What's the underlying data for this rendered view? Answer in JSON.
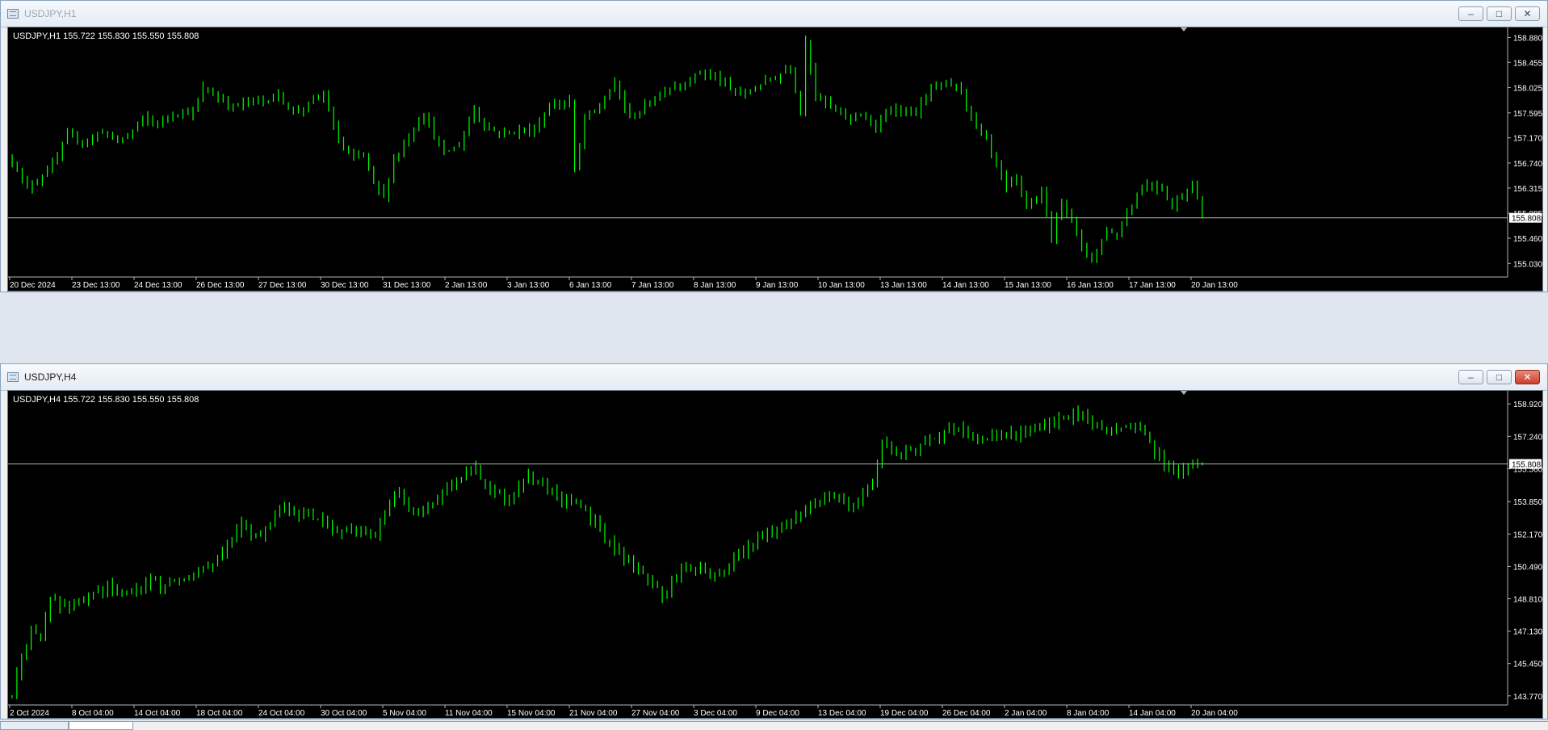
{
  "windows": [
    {
      "title": "USDJPY,H1",
      "active": false,
      "info": "USDJPY,H1  155.722 155.830 155.550 155.808",
      "chart_data": {
        "type": "candlestick",
        "symbol": "USDJPY",
        "timeframe": "H1",
        "ylim": [
          154.8,
          159.05
        ],
        "y_ticks": [
          "158.880",
          "158.455",
          "158.025",
          "157.595",
          "157.170",
          "156.740",
          "156.315",
          "155.885",
          "155.460",
          "155.030"
        ],
        "x_ticks": [
          "20 Dec 2024",
          "23 Dec 13:00",
          "24 Dec 13:00",
          "26 Dec 13:00",
          "27 Dec 13:00",
          "30 Dec 13:00",
          "31 Dec 13:00",
          "2 Jan 13:00",
          "3 Jan 13:00",
          "6 Jan 13:00",
          "7 Jan 13:00",
          "8 Jan 13:00",
          "9 Jan 13:00",
          "10 Jan 13:00",
          "13 Jan 13:00",
          "14 Jan 13:00",
          "15 Jan 13:00",
          "16 Jan 13:00",
          "17 Jan 13:00",
          "20 Jan 13:00"
        ],
        "current_price": "155.808",
        "path": [
          [
            0,
            156.8
          ],
          [
            3,
            156.3
          ],
          [
            6,
            156.55
          ],
          [
            8,
            156.7
          ],
          [
            11,
            157.2
          ],
          [
            15,
            157.1
          ],
          [
            18,
            157.3
          ],
          [
            21,
            157.1
          ],
          [
            24,
            157.3
          ],
          [
            26,
            157.5
          ],
          [
            29,
            157.4
          ],
          [
            32,
            157.6
          ],
          [
            36,
            157.6
          ],
          [
            38,
            158.0
          ],
          [
            40,
            157.9
          ],
          [
            44,
            157.7
          ],
          [
            47,
            157.8
          ],
          [
            50,
            157.8
          ],
          [
            53,
            157.9
          ],
          [
            56,
            157.6
          ],
          [
            60,
            157.8
          ],
          [
            62,
            157.9
          ],
          [
            65,
            157.1
          ],
          [
            68,
            156.8
          ],
          [
            70,
            156.9
          ],
          [
            72,
            156.4
          ],
          [
            74,
            156.15
          ],
          [
            76,
            156.8
          ],
          [
            79,
            157.2
          ],
          [
            82,
            157.6
          ],
          [
            84,
            157.2
          ],
          [
            86,
            156.9
          ],
          [
            89,
            157.05
          ],
          [
            92,
            157.65
          ],
          [
            95,
            157.3
          ],
          [
            98,
            157.25
          ],
          [
            101,
            157.3
          ],
          [
            104,
            157.3
          ],
          [
            107,
            157.7
          ],
          [
            111,
            157.8
          ],
          [
            112,
            156.6
          ],
          [
            114,
            157.5
          ],
          [
            117,
            157.7
          ],
          [
            120,
            158.1
          ],
          [
            123,
            157.5
          ],
          [
            126,
            157.7
          ],
          [
            130,
            158.0
          ],
          [
            134,
            158.1
          ],
          [
            137,
            158.3
          ],
          [
            140,
            158.2
          ],
          [
            143,
            158.0
          ],
          [
            146,
            157.9
          ],
          [
            149,
            158.1
          ],
          [
            152,
            158.2
          ],
          [
            155,
            158.4
          ],
          [
            157,
            157.6
          ],
          [
            158,
            158.85
          ],
          [
            160,
            157.9
          ],
          [
            163,
            157.7
          ],
          [
            166,
            157.5
          ],
          [
            169,
            157.6
          ],
          [
            172,
            157.3
          ],
          [
            175,
            157.7
          ],
          [
            178,
            157.6
          ],
          [
            180,
            157.6
          ],
          [
            183,
            158.0
          ],
          [
            186,
            158.1
          ],
          [
            189,
            158.0
          ],
          [
            191,
            157.5
          ],
          [
            194,
            157.1
          ],
          [
            196,
            156.7
          ],
          [
            198,
            156.3
          ],
          [
            200,
            156.5
          ],
          [
            202,
            156.0
          ],
          [
            205,
            156.2
          ],
          [
            207,
            155.5
          ],
          [
            209,
            156.1
          ],
          [
            211,
            155.8
          ],
          [
            213,
            155.3
          ],
          [
            215,
            155.1
          ],
          [
            218,
            155.6
          ],
          [
            220,
            155.5
          ],
          [
            222,
            155.9
          ],
          [
            224,
            156.2
          ],
          [
            226,
            156.4
          ],
          [
            229,
            156.3
          ],
          [
            231,
            156.0
          ],
          [
            233,
            156.2
          ],
          [
            235,
            156.4
          ],
          [
            237,
            155.85
          ]
        ]
      }
    },
    {
      "title": "USDJPY,H4",
      "active": true,
      "info": "USDJPY,H4  155.722 155.830 155.550 155.808",
      "chart_data": {
        "type": "candlestick",
        "symbol": "USDJPY",
        "timeframe": "H4",
        "ylim": [
          143.3,
          159.6
        ],
        "y_ticks": [
          "158.920",
          "157.240",
          "155.560",
          "153.850",
          "152.170",
          "150.490",
          "148.810",
          "147.130",
          "145.450",
          "143.770"
        ],
        "x_ticks": [
          "2 Oct 2024",
          "8 Oct 04:00",
          "14 Oct 04:00",
          "18 Oct 04:00",
          "24 Oct 04:00",
          "30 Oct 04:00",
          "5 Nov 04:00",
          "11 Nov 04:00",
          "15 Nov 04:00",
          "21 Nov 04:00",
          "27 Nov 04:00",
          "3 Dec 04:00",
          "9 Dec 04:00",
          "13 Dec 04:00",
          "19 Dec 04:00",
          "26 Dec 04:00",
          "2 Jan 04:00",
          "8 Jan 04:00",
          "14 Jan 04:00",
          "20 Jan 04:00"
        ],
        "current_price": "155.808",
        "path": [
          [
            0,
            143.8
          ],
          [
            2,
            146.0
          ],
          [
            4,
            147.0
          ],
          [
            6,
            146.8
          ],
          [
            8,
            148.8
          ],
          [
            12,
            148.2
          ],
          [
            16,
            148.9
          ],
          [
            20,
            149.5
          ],
          [
            24,
            149.0
          ],
          [
            28,
            149.7
          ],
          [
            32,
            149.5
          ],
          [
            36,
            150.0
          ],
          [
            40,
            150.3
          ],
          [
            44,
            151.2
          ],
          [
            48,
            152.6
          ],
          [
            52,
            152.0
          ],
          [
            56,
            153.5
          ],
          [
            60,
            153.2
          ],
          [
            64,
            153.0
          ],
          [
            68,
            152.3
          ],
          [
            72,
            152.5
          ],
          [
            76,
            152.0
          ],
          [
            80,
            154.5
          ],
          [
            84,
            153.1
          ],
          [
            88,
            153.8
          ],
          [
            92,
            154.8
          ],
          [
            96,
            155.7
          ],
          [
            100,
            154.5
          ],
          [
            104,
            154.0
          ],
          [
            108,
            155.2
          ],
          [
            112,
            154.4
          ],
          [
            116,
            153.9
          ],
          [
            120,
            153.5
          ],
          [
            124,
            152.0
          ],
          [
            128,
            150.8
          ],
          [
            132,
            150.2
          ],
          [
            136,
            149.0
          ],
          [
            140,
            150.5
          ],
          [
            144,
            150.3
          ],
          [
            148,
            150.0
          ],
          [
            152,
            151.2
          ],
          [
            156,
            151.9
          ],
          [
            160,
            152.5
          ],
          [
            164,
            153.0
          ],
          [
            168,
            153.8
          ],
          [
            172,
            154.2
          ],
          [
            176,
            153.5
          ],
          [
            180,
            155.0
          ],
          [
            182,
            157.0
          ],
          [
            186,
            156.3
          ],
          [
            190,
            156.8
          ],
          [
            194,
            157.3
          ],
          [
            198,
            157.6
          ],
          [
            202,
            157.0
          ],
          [
            206,
            157.2
          ],
          [
            210,
            157.3
          ],
          [
            214,
            157.8
          ],
          [
            218,
            157.9
          ],
          [
            222,
            158.4
          ],
          [
            226,
            157.9
          ],
          [
            230,
            157.5
          ],
          [
            234,
            157.9
          ],
          [
            237,
            157.3
          ],
          [
            240,
            156.2
          ],
          [
            243,
            155.3
          ],
          [
            246,
            155.7
          ],
          [
            249,
            155.8
          ]
        ]
      }
    }
  ],
  "colors": {
    "background": "#000000",
    "candle": "#00ff00",
    "grid": "#b4b4b4",
    "text": "#ffffff"
  },
  "bottom_tabs": [
    "",
    ""
  ]
}
